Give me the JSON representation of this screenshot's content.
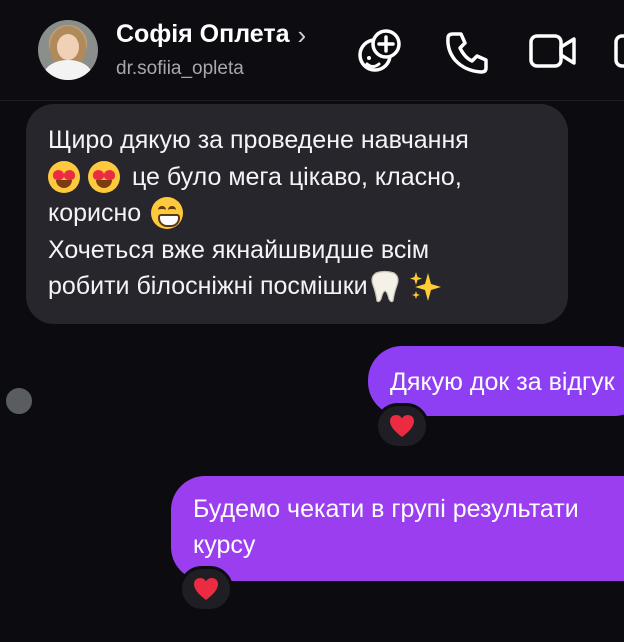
{
  "header": {
    "name": "Софія Оплета",
    "handle": "dr.sofiia_opleta",
    "icons": [
      "effects-icon",
      "phone-call-icon",
      "video-call-icon"
    ]
  },
  "messages": [
    {
      "direction": "incoming",
      "lines": [
        "Щиро дякую за проведене навчання",
        "це було мега цікаво, класно,",
        "корисно",
        "Хочеться вже якнайшвидше всім",
        "робити білосніжні посмішки"
      ],
      "emojis": [
        "heart-eyes",
        "heart-eyes",
        "grinning",
        "tooth",
        "sparkles"
      ]
    },
    {
      "direction": "outgoing",
      "text": "Дякую док за відгук",
      "reaction": "red-heart"
    },
    {
      "direction": "outgoing",
      "lines": [
        "Будемо чекати в групі результати",
        "курсу"
      ],
      "reaction": "red-heart"
    }
  ],
  "colors": {
    "background": "#0b0b10",
    "incoming_bubble": "#26262c",
    "outgoing_bubble": "#8f3ff3",
    "heart": "#ea2b42"
  }
}
